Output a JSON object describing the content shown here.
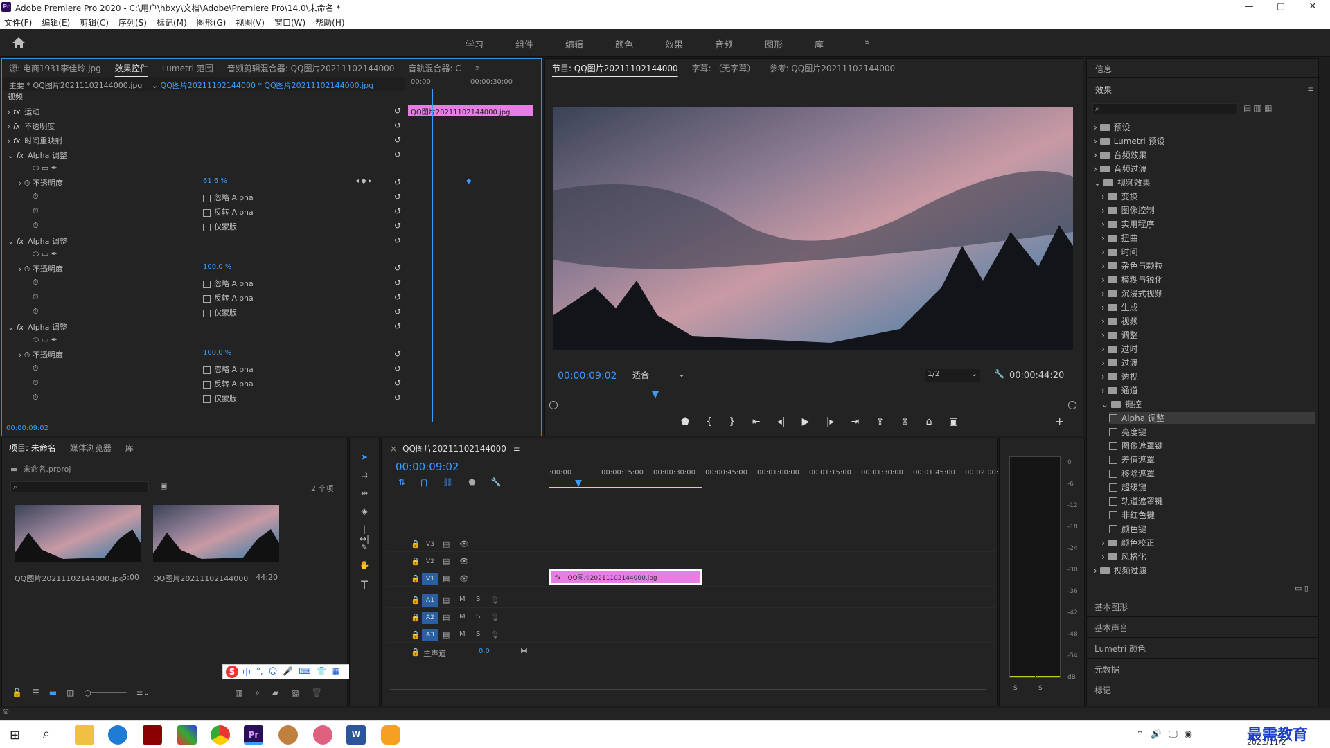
{
  "window": {
    "title": "Adobe Premiere Pro 2020 - C:\\用户\\hbxy\\文档\\Adobe\\Premiere Pro\\14.0\\未命名 *",
    "logo": "Pr",
    "minimize": "—",
    "maximize": "▢",
    "close": "✕"
  },
  "menu": [
    "文件(F)",
    "编辑(E)",
    "剪辑(C)",
    "序列(S)",
    "标记(M)",
    "图形(G)",
    "视图(V)",
    "窗口(W)",
    "帮助(H)"
  ],
  "workspaces": [
    "学习",
    "组件",
    "编辑",
    "颜色",
    "效果",
    "音频",
    "图形",
    "库"
  ],
  "workspaces_more": "»",
  "source_panel": {
    "tabs": [
      "源: 电商1931李佳玲.jpg",
      "效果控件",
      "Lumetri 范围",
      "音频剪辑混合器: QQ图片20211102144000",
      "音轨混合器: C"
    ],
    "master": "主要 * QQ图片20211102144000.jpg",
    "clip": "QQ图片20211102144000 * QQ图片20211102144000.jpg",
    "ruler": [
      "00:00",
      "00:00:30:00"
    ],
    "clip_bar": "QQ图片20211102144000.jpg",
    "section": "视频",
    "effects": [
      {
        "label": "运动"
      },
      {
        "label": "不透明度"
      },
      {
        "label": "时间重映射"
      }
    ],
    "alpha_blocks": [
      {
        "title": "Alpha 调整",
        "opacity_label": "不透明度",
        "opacity": "61.6 %",
        "opts": [
          "忽略 Alpha",
          "反转 Alpha",
          "仅蒙版"
        ]
      },
      {
        "title": "Alpha 调整",
        "opacity_label": "不透明度",
        "opacity": "100.0 %",
        "opts": [
          "忽略 Alpha",
          "反转 Alpha",
          "仅蒙版"
        ]
      },
      {
        "title": "Alpha 调整",
        "opacity_label": "不透明度",
        "opacity": "100.0 %",
        "opts": [
          "忽略 Alpha",
          "反转 Alpha",
          "仅蒙版"
        ]
      }
    ],
    "timecode": "00:00:09:02"
  },
  "program": {
    "tabs": [
      "节目: QQ图片20211102144000",
      "字幕: （无字幕）",
      "参考: QQ图片20211102144000"
    ],
    "timecode": "00:00:09:02",
    "fit": "适合",
    "resolution": "1/2",
    "duration": "00:00:44:20"
  },
  "project": {
    "tabs": [
      "项目: 未命名",
      "媒体浏览器",
      "库"
    ],
    "file": "未命名.prproj",
    "count": "2 个项",
    "items": [
      {
        "name": "QQ图片20211102144000.jpg",
        "dur": "5:00"
      },
      {
        "name": "QQ图片20211102144000",
        "dur": "44:20"
      }
    ]
  },
  "timeline": {
    "tab": "QQ图片20211102144000",
    "timecode": "00:00:09:02",
    "ruler": [
      ":00:00",
      "00:00:15:00",
      "00:00:30:00",
      "00:00:45:00",
      "00:01:00:00",
      "00:01:15:00",
      "00:01:30:00",
      "00:01:45:00",
      "00:02:00:0"
    ],
    "video_tracks": [
      "V3",
      "V2",
      "V1"
    ],
    "audio_tracks": [
      "A1",
      "A2",
      "A3"
    ],
    "master": "主声道",
    "master_val": "0.0",
    "clip": "QQ图片20211102144000.jpg",
    "m": "M",
    "s": "S"
  },
  "meter": {
    "scale": [
      "0",
      "-6",
      "-12",
      "-18",
      "-24",
      "-30",
      "-36",
      "-42",
      "-48",
      "-54",
      "dB"
    ],
    "solo": [
      "S",
      "S"
    ]
  },
  "info_title": "信息",
  "effects_panel": {
    "title": "效果",
    "tree": [
      {
        "label": "预设",
        "lvl": 0,
        "open": false
      },
      {
        "label": "Lumetri 预设",
        "lvl": 0,
        "open": false
      },
      {
        "label": "音频效果",
        "lvl": 0,
        "open": false
      },
      {
        "label": "音频过渡",
        "lvl": 0,
        "open": false
      },
      {
        "label": "视频效果",
        "lvl": 0,
        "open": true
      },
      {
        "label": "变换",
        "lvl": 1,
        "open": false
      },
      {
        "label": "图像控制",
        "lvl": 1,
        "open": false
      },
      {
        "label": "实用程序",
        "lvl": 1,
        "open": false
      },
      {
        "label": "扭曲",
        "lvl": 1,
        "open": false
      },
      {
        "label": "时间",
        "lvl": 1,
        "open": false
      },
      {
        "label": "杂色与颗粒",
        "lvl": 1,
        "open": false
      },
      {
        "label": "模糊与锐化",
        "lvl": 1,
        "open": false
      },
      {
        "label": "沉浸式视频",
        "lvl": 1,
        "open": false
      },
      {
        "label": "生成",
        "lvl": 1,
        "open": false
      },
      {
        "label": "视频",
        "lvl": 1,
        "open": false
      },
      {
        "label": "调整",
        "lvl": 1,
        "open": false
      },
      {
        "label": "过时",
        "lvl": 1,
        "open": false
      },
      {
        "label": "过渡",
        "lvl": 1,
        "open": false
      },
      {
        "label": "透视",
        "lvl": 1,
        "open": false
      },
      {
        "label": "通道",
        "lvl": 1,
        "open": false
      },
      {
        "label": "键控",
        "lvl": 1,
        "open": true
      },
      {
        "label": "Alpha 调整",
        "lvl": 2,
        "sel": true
      },
      {
        "label": "亮度键",
        "lvl": 2
      },
      {
        "label": "图像遮罩键",
        "lvl": 2
      },
      {
        "label": "差值遮罩",
        "lvl": 2
      },
      {
        "label": "移除遮罩",
        "lvl": 2
      },
      {
        "label": "超级键",
        "lvl": 2
      },
      {
        "label": "轨道遮罩键",
        "lvl": 2
      },
      {
        "label": "非红色键",
        "lvl": 2
      },
      {
        "label": "颜色键",
        "lvl": 2
      },
      {
        "label": "颜色校正",
        "lvl": 1,
        "open": false
      },
      {
        "label": "风格化",
        "lvl": 1,
        "open": false
      },
      {
        "label": "视频过渡",
        "lvl": 0,
        "open": false
      }
    ]
  },
  "right_sections": [
    "基本图形",
    "基本声音",
    "Lumetri 颜色",
    "元数据",
    "标记"
  ],
  "ime": [
    "中",
    "°,",
    "☺",
    "🎤",
    "⌨",
    "👕",
    "▦"
  ],
  "tray": {
    "time": "",
    "date": "2021/11/2",
    "watermark": "最需教育"
  }
}
